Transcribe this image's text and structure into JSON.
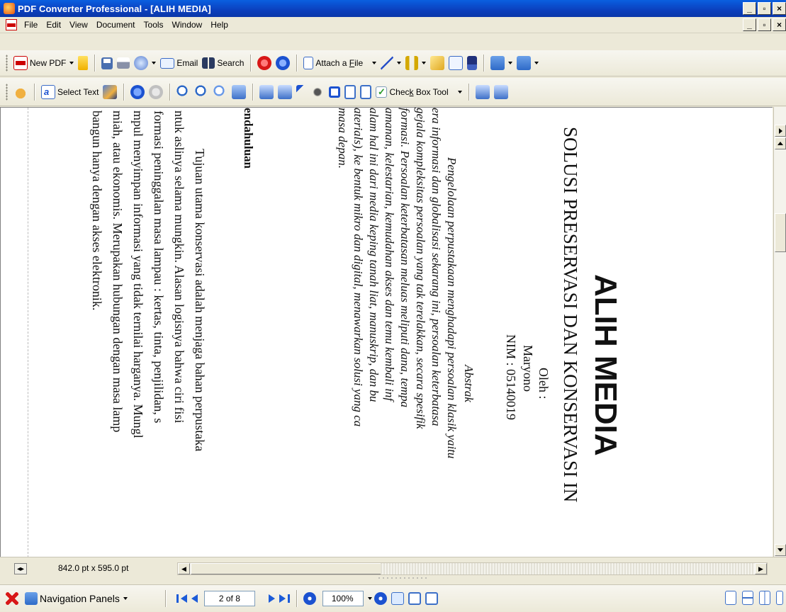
{
  "window": {
    "title": "PDF Converter Professional - [ALIH MEDIA]",
    "minimize": "_",
    "maximize": "▫",
    "close": "×"
  },
  "menu": {
    "items": [
      "File",
      "Edit",
      "View",
      "Document",
      "Tools",
      "Window",
      "Help"
    ],
    "minimize": "_",
    "restore": "▫",
    "close": "×"
  },
  "toolbar1": {
    "new_pdf": "New PDF",
    "email": "Email",
    "search": "Search",
    "attach_file_pre": "Attach a ",
    "attach_file_key": "F",
    "attach_file_post": "ile"
  },
  "toolbar2": {
    "select_text": "Select Text",
    "checkbox_tool_pre": "Chec",
    "checkbox_tool_key": "k",
    "checkbox_tool_post": " Box Tool"
  },
  "document": {
    "title": "ALIH MEDIA",
    "subtitle": "SOLUSI PRESERVASI DAN KONSERVASI IN",
    "oleh": "Oleh :",
    "author": "Maryono",
    "nim": "NIM : 05140019",
    "abstract_heading": "Abstrak",
    "abstract_lines": [
      "Pengelolaan perpustakaan menghadapi persoalan klasik yaitu",
      "era informasi dan globalisasi sekarang ini, persoalan keterbatasa",
      "gejala kompleksitas persoalan yang tak terelakkan, secara spesifik",
      "formasi.  Persoalan  keterbatasan  meluas  meliputi  dana,  tempa",
      "amanan,  kelestarian,  kemudahan  akses  dan  temu  kembali  inf",
      "alam  hal  ini  dari  media  keping  tanah  liat,  manuskrip,  dan  bu",
      "aterials), ke bentuk mikro dan digital, menawarkan solusi yang ca",
      "masa depan."
    ],
    "section_heading": "endahuluan",
    "body_lines": [
      "Tujuan utama konservasi adalah menjaga bahan perpustaka",
      "ntuk aslinya selama mungkin. Alasan logisnya bahwa ciri fisi",
      "formasi peninggalan masa lampau : kertas, tinta, penjilidan, s",
      "mpul menyimpan informasi yang tidak ternilai harganya. Mungl",
      "miah, atau ekonomis. Merupakan hubungan dengan masa lamp",
      "bangun hanya dengan akses elektronik."
    ]
  },
  "hbar": {
    "page_size": "842.0 pt x 595.0 pt"
  },
  "status": {
    "nav_panels": "Navigation Panels",
    "page_field": "2 of 8",
    "zoom": "100%"
  }
}
